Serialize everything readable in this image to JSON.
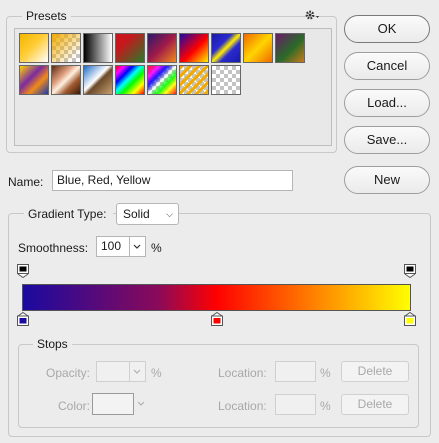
{
  "presets": {
    "title": "Presets",
    "gear_icon": "gear-icon",
    "swatches": [
      {
        "name": "foreground-to-background",
        "css": "linear-gradient(135deg,#f2b600 0%,#ffcc33 45%,#ffffff 100%)",
        "checker": false
      },
      {
        "name": "foreground-to-transparent",
        "css": "linear-gradient(135deg,rgba(240,170,0,1) 0%,rgba(240,170,0,0) 85%)",
        "checker": true
      },
      {
        "name": "black-white",
        "css": "linear-gradient(90deg,#000 0%,#fff 100%)",
        "checker": false
      },
      {
        "name": "red-green",
        "css": "linear-gradient(135deg,#c8161d 30%,#2a7a2a 100%)",
        "checker": false
      },
      {
        "name": "violet-orange",
        "css": "linear-gradient(135deg,#2a1a6a 0%,#a01a4a 50%,#f08a1a 100%)",
        "checker": false
      },
      {
        "name": "blue-red-yellow",
        "css": "linear-gradient(135deg,#1a0aa8 0%,#ff0000 55%,#ffee00 100%)",
        "checker": false
      },
      {
        "name": "blue-yellow-blue",
        "css": "linear-gradient(135deg,#1a1aa8 0%,#2a2ad0 35%,#ffee00 50%,#2a2ad0 65%,#1a1aa8 100%)",
        "checker": false
      },
      {
        "name": "orange-yellow-orange",
        "css": "linear-gradient(135deg,#f06a00 0%,#ffd400 50%,#f06a00 100%)",
        "checker": false
      },
      {
        "name": "violet-green-orange",
        "css": "linear-gradient(135deg,#6a1a6a 0%,#2a6a2a 55%,#c87a1a 100%)",
        "checker": false
      },
      {
        "name": "yellow-violet-orange-blue",
        "css": "linear-gradient(135deg,#ffd400 0%,#7a2aa0 40%,#f08a1a 65%,#1a3aa8 100%)",
        "checker": false
      },
      {
        "name": "copper",
        "css": "linear-gradient(135deg,#5a2a10 0%,#e0a080 35%,#fff0e0 50%,#a05a30 70%,#3a1a08 100%)",
        "checker": false
      },
      {
        "name": "chrome",
        "css": "linear-gradient(135deg,#1a6ac8 0%,#ffffff 45%,#6a4a2a 55%,#c8a070 100%)",
        "checker": false
      },
      {
        "name": "spectrum",
        "css": "linear-gradient(135deg,#ff0000 0%,#ff00ff 15%,#0000ff 30%,#00ffff 45%,#00ff00 60%,#ffff00 80%,#ff0000 100%)",
        "checker": false
      },
      {
        "name": "transparent-rainbow",
        "css": "linear-gradient(135deg,rgba(255,0,0,0.9) 0%,rgba(255,0,255,0.9) 20%,rgba(0,0,255,0.9) 35%,rgba(255,255,255,0) 50%,rgba(0,255,0,0.9) 65%,rgba(255,255,0,0.9) 80%,rgba(255,0,0,0.9) 100%)",
        "checker": true
      },
      {
        "name": "transparent-stripes",
        "css": "repeating-linear-gradient(135deg,rgba(240,170,0,1) 0px,rgba(240,170,0,1) 3px,rgba(240,170,0,0) 3px,rgba(240,170,0,0) 6px)",
        "checker": true
      },
      {
        "name": "transparent-checker",
        "css": "linear-gradient(0deg,rgba(0,0,0,0),rgba(0,0,0,0))",
        "checker": true
      }
    ]
  },
  "buttons": {
    "ok": "OK",
    "cancel": "Cancel",
    "load": "Load...",
    "save": "Save...",
    "new": "New"
  },
  "name": {
    "label": "Name:",
    "value": "Blue, Red, Yellow"
  },
  "gradient_type": {
    "label": "Gradient Type:",
    "value": "Solid",
    "chevron_icon": "chevron-updown-icon"
  },
  "smoothness": {
    "label": "Smoothness:",
    "value": "100",
    "unit": "%",
    "chevron_icon": "chevron-down-icon"
  },
  "gradient_bar": {
    "css": "linear-gradient(90deg,#1a0aa0 0%,#8a0a5a 35%,#ff0000 50%,#ff8000 75%,#ffff00 100%)",
    "opacity_stops": [
      0,
      1
    ],
    "color_stops": [
      {
        "position": 0,
        "color": "#1a0aa0"
      },
      {
        "position": 0.5,
        "color": "#ff0000"
      },
      {
        "position": 1,
        "color": "#ffff00"
      }
    ]
  },
  "stops": {
    "title": "Stops",
    "opacity_label": "Opacity:",
    "opacity_unit": "%",
    "color_label": "Color:",
    "location_label": "Location:",
    "location_unit": "%",
    "delete_label": "Delete"
  }
}
